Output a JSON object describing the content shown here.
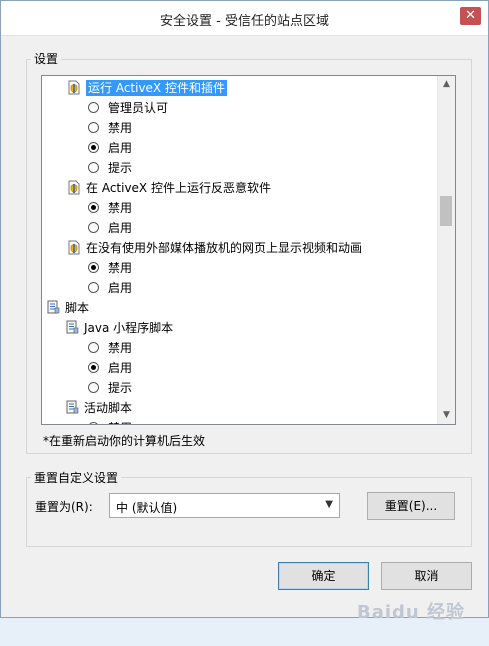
{
  "window": {
    "title": "安全设置 - 受信任的站点区域",
    "close_glyph": "✕"
  },
  "settings_group": {
    "legend": "设置"
  },
  "list_items": [
    {
      "kind": "header",
      "icon": "document-shield-icon",
      "label": "运行 ActiveX 控件和插件",
      "selected": true
    },
    {
      "kind": "option",
      "label": "管理员认可",
      "checked": false
    },
    {
      "kind": "option",
      "label": "禁用",
      "checked": false
    },
    {
      "kind": "option",
      "label": "启用",
      "checked": true
    },
    {
      "kind": "option",
      "label": "提示",
      "checked": false
    },
    {
      "kind": "header",
      "icon": "document-shield-icon",
      "label": "在 ActiveX 控件上运行反恶意软件",
      "selected": false
    },
    {
      "kind": "option",
      "label": "禁用",
      "checked": true
    },
    {
      "kind": "option",
      "label": "启用",
      "checked": false
    },
    {
      "kind": "header",
      "icon": "document-shield-icon",
      "label": "在没有使用外部媒体播放机的网页上显示视频和动画",
      "selected": false
    },
    {
      "kind": "option",
      "label": "禁用",
      "checked": true
    },
    {
      "kind": "option",
      "label": "启用",
      "checked": false
    },
    {
      "kind": "category",
      "icon": "script-icon",
      "label": "脚本"
    },
    {
      "kind": "header",
      "icon": "script-icon",
      "label": "Java 小程序脚本",
      "selected": false
    },
    {
      "kind": "option",
      "label": "禁用",
      "checked": false
    },
    {
      "kind": "option",
      "label": "启用",
      "checked": true
    },
    {
      "kind": "option",
      "label": "提示",
      "checked": false
    },
    {
      "kind": "header",
      "icon": "script-icon",
      "label": "活动脚本",
      "selected": false
    },
    {
      "kind": "option",
      "label": "禁用",
      "checked": false
    }
  ],
  "note": "*在重新启动你的计算机后生效",
  "reset_group": {
    "legend": "重置自定义设置",
    "reset_to_label": "重置为(R):",
    "select_value": "中 (默认值)",
    "reset_button": "重置(E)..."
  },
  "buttons": {
    "ok": "确定",
    "cancel": "取消"
  },
  "watermark": "Baidu 经验",
  "colors": {
    "selection": "#3399ff",
    "close_button": "#c75050"
  }
}
